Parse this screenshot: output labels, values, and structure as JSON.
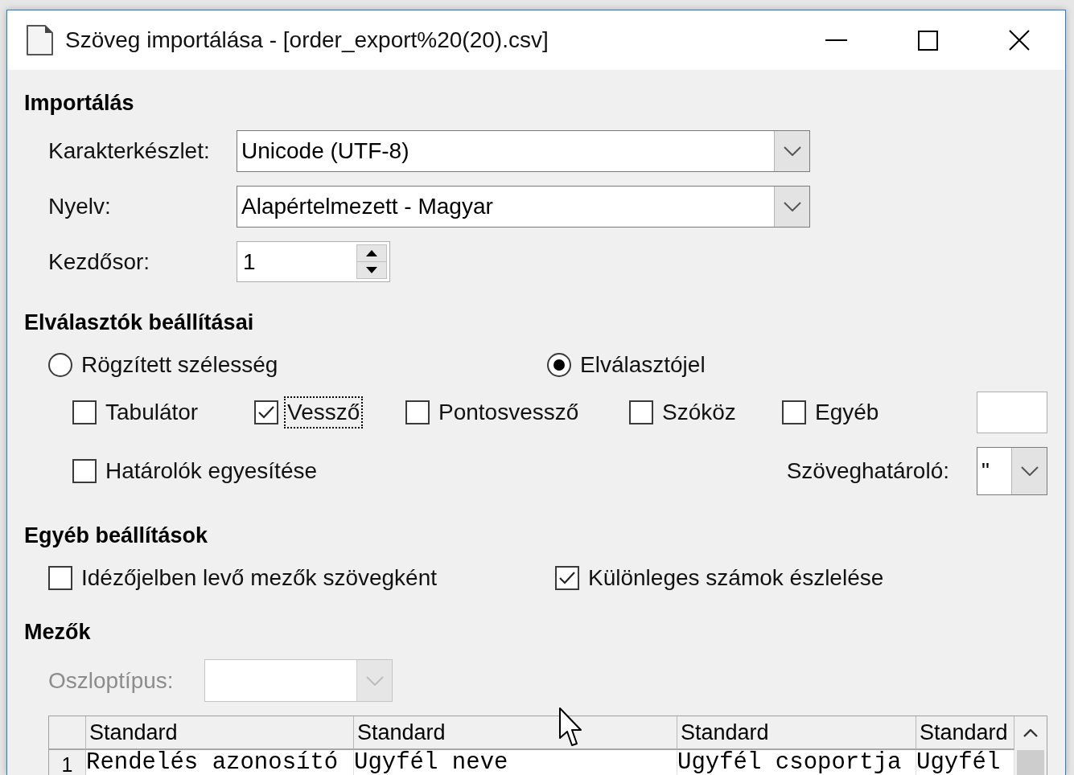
{
  "window": {
    "title": "Szöveg importálása - [order_export%20(20).csv]"
  },
  "import": {
    "heading": "Importálás",
    "fields": [
      {
        "kind": "combo",
        "label": "Karakterkészlet:",
        "value": "Unicode (UTF-8)"
      },
      {
        "kind": "combo",
        "label": "Nyelv:",
        "value": "Alapértelmezett - Magyar"
      },
      {
        "kind": "spin",
        "label": "Kezdősor:",
        "value": "1"
      }
    ]
  },
  "separator_options": {
    "heading": "Elválasztók beállításai",
    "modes": [
      {
        "label": "Rögzített szélesség",
        "selected": false
      },
      {
        "label": "Elválasztójel",
        "selected": true
      }
    ],
    "separators": [
      {
        "label": "Tabulátor",
        "checked": false,
        "focused": false
      },
      {
        "label": "Vessző",
        "checked": true,
        "focused": true
      },
      {
        "label": "Pontosvessző",
        "checked": false,
        "focused": false
      },
      {
        "label": "Szóköz",
        "checked": false,
        "focused": false
      },
      {
        "label": "Egyéb",
        "checked": false,
        "focused": false
      }
    ],
    "merge_delimiters": {
      "label": "Határolók egyesítése",
      "checked": false
    },
    "string_delimiter": {
      "label": "Szöveghatároló:",
      "value": "\""
    }
  },
  "other_options": {
    "heading": "Egyéb beállítások",
    "options": [
      {
        "label": "Idézőjelben levő mezők szövegként",
        "checked": false
      },
      {
        "label": "Különleges számok észlelése",
        "checked": true
      }
    ]
  },
  "fields": {
    "heading": "Mezők",
    "column_type": {
      "label": "Oszloptípus:",
      "disabled": true
    },
    "table": {
      "columns": [
        "Standard",
        "Standard",
        "Standard",
        "Standard"
      ],
      "rows": [
        {
          "number": "1",
          "cells": [
            "Rendelés azonosító",
            "Ugyfél neve",
            "Ugyfél csoportja",
            "Ugyfél"
          ]
        }
      ]
    }
  }
}
